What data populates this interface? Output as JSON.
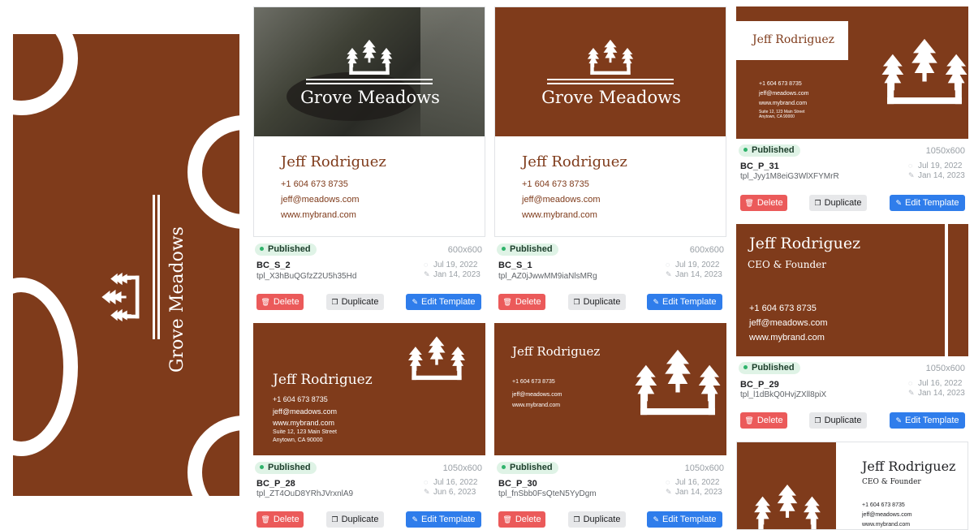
{
  "brand": {
    "company": "Grove Meadows",
    "person": "Jeff Rodriguez",
    "role": "CEO & Founder",
    "phone": "+1 604 673 8735",
    "email": "jeff@meadows.com",
    "web": "www.mybrand.com",
    "address_line1": "Suite 12, 123 Main Street",
    "address_line2": "Anytown, CA 90000"
  },
  "colors": {
    "brand_brown": "#7f3b1b",
    "published_green": "#2fb36b",
    "delete_red": "#eb5a5a",
    "edit_blue": "#2f7deb"
  },
  "actions": {
    "delete": "Delete",
    "duplicate": "Duplicate",
    "edit": "Edit Template"
  },
  "status": {
    "published": "Published"
  },
  "templates": [
    {
      "code": "BC_S_2",
      "tpl_id": "tpl_X3hBuQGfzZ2U5h35Hd",
      "size": "600x600",
      "created": "Jul 19, 2022",
      "updated": "Jan 14, 2023"
    },
    {
      "code": "BC_S_1",
      "tpl_id": "tpl_AZ0jJwwMM9iaNlsMRg",
      "size": "600x600",
      "created": "Jul 19, 2022",
      "updated": "Jan 14, 2023"
    },
    {
      "code": "BC_P_31",
      "tpl_id": "tpl_Jyy1M8eiG3WlXFYMrR",
      "size": "1050x600",
      "created": "Jul 19, 2022",
      "updated": "Jan 14, 2023"
    },
    {
      "code": "BC_P_28",
      "tpl_id": "tpl_ZT4OuD8YRhJVrxnlA9",
      "size": "1050x600",
      "created": "Jul 16, 2022",
      "updated": "Jun 6, 2023"
    },
    {
      "code": "BC_P_30",
      "tpl_id": "tpl_fnSbb0FsQteN5YyDgm",
      "size": "1050x600",
      "created": "Jul 16, 2022",
      "updated": "Jan 14, 2023"
    },
    {
      "code": "BC_P_29",
      "tpl_id": "tpl_l1dBkQ0HvjZXll8piX",
      "size": "1050x600",
      "created": "Jul 16, 2022",
      "updated": "Jan 14, 2023"
    }
  ],
  "icons": {
    "trash": "trash-icon",
    "copy": "copy-icon",
    "pencil": "pencil-icon",
    "calendar": "calendar-icon",
    "edit_date": "edit-date-icon",
    "tree": "pine-tree-logo"
  }
}
